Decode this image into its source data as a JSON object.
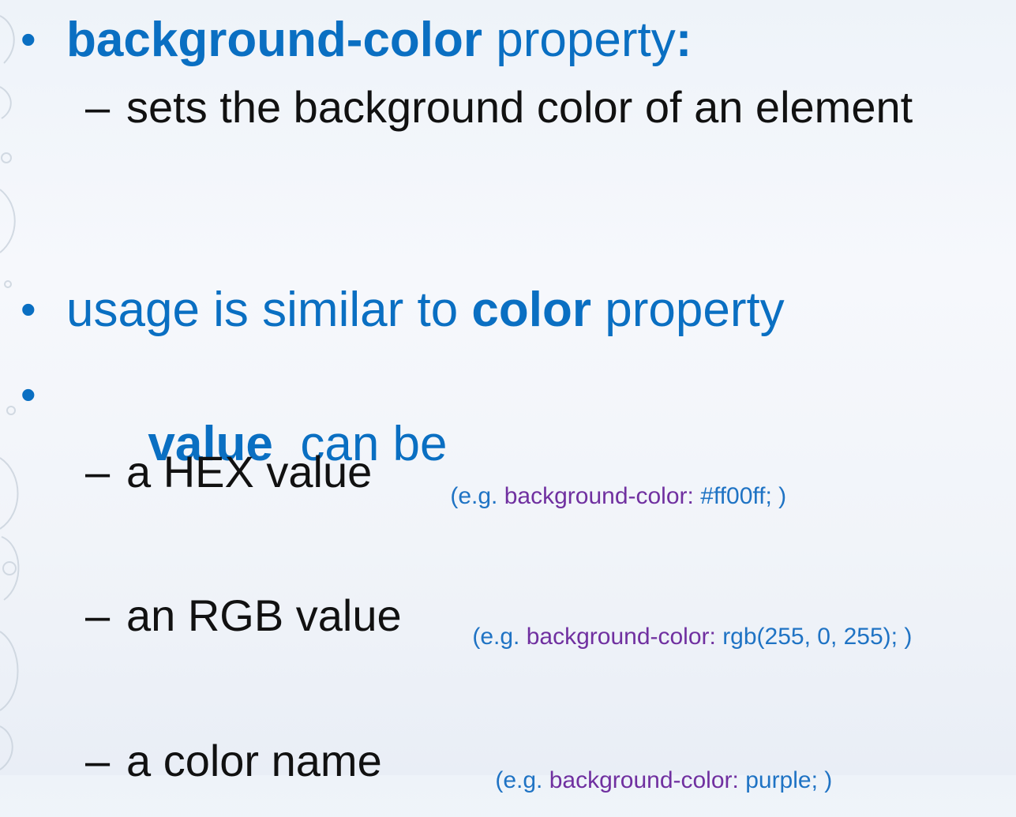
{
  "slide": {
    "items": [
      {
        "bullet": "•",
        "bold": "background-color",
        "rest": " property",
        "colon": ":"
      },
      {
        "dash": "–",
        "text": "sets the background color of an element"
      },
      {
        "bullet": "•",
        "pre": "usage is similar to ",
        "bold": "color",
        "rest": " property"
      },
      {
        "bullet": "•",
        "bold": "value",
        "rest": "  can be"
      },
      {
        "dash": "–",
        "text": "a HEX value",
        "example_open": "(e.g. ",
        "example_prop": "background-color:",
        "example_value": " #ff00ff; )"
      },
      {
        "dash": "–",
        "text": "an RGB value",
        "example_open": "(e.g. ",
        "example_prop": "background-color:",
        "example_value": " rgb(255, 0, 255); )"
      },
      {
        "dash": "–",
        "text": "a color name",
        "example_open": "(e.g. ",
        "example_prop": "background-color:",
        "example_value": " purple; )"
      }
    ]
  },
  "colors": {
    "heading_blue": "#0a6fc2",
    "body_text": "#111111",
    "example_blue": "#1f73c4",
    "example_purple": "#7030a0"
  }
}
